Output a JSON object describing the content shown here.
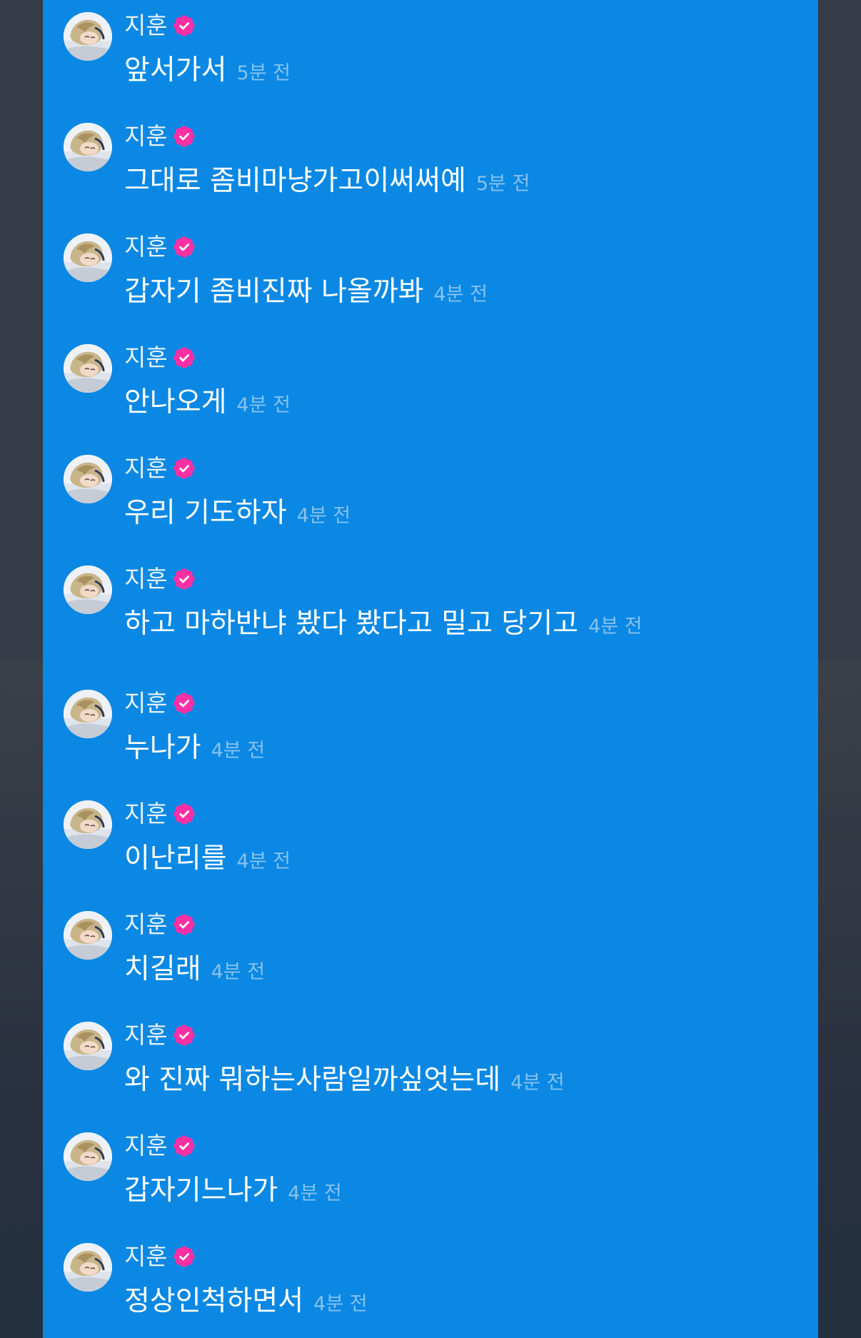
{
  "messages": [
    {
      "name": "지훈",
      "text": "앞서가서",
      "time": "5분 전"
    },
    {
      "name": "지훈",
      "text": "그대로 좀비마냥가고이써써예",
      "time": "5분 전"
    },
    {
      "name": "지훈",
      "text": "갑자기 좀비진짜 나올까봐",
      "time": "4분 전"
    },
    {
      "name": "지훈",
      "text": "안나오게",
      "time": "4분 전"
    },
    {
      "name": "지훈",
      "text": "우리 기도하자",
      "time": "4분 전"
    },
    {
      "name": "지훈",
      "text": "하고 마하반냐 봤다 봤다고 밀고 당기고",
      "time": "4분 전"
    },
    {
      "name": "지훈",
      "text": "누나가",
      "time": "4분 전"
    },
    {
      "name": "지훈",
      "text": "이난리를",
      "time": "4분 전"
    },
    {
      "name": "지훈",
      "text": "치길래",
      "time": "4분 전"
    },
    {
      "name": "지훈",
      "text": "와 진짜 뭐하는사람일까싶엇는데",
      "time": "4분 전"
    },
    {
      "name": "지훈",
      "text": "갑자기느나가",
      "time": "4분 전"
    },
    {
      "name": "지훈",
      "text": "정상인척하면서",
      "time": "4분 전"
    }
  ],
  "icons": {
    "verified": "verified-check-icon",
    "avatar": "user-avatar"
  },
  "colors": {
    "panel": "#0a88e4",
    "badge": "#ff2fa4",
    "timestamp": "#86c2ee"
  }
}
